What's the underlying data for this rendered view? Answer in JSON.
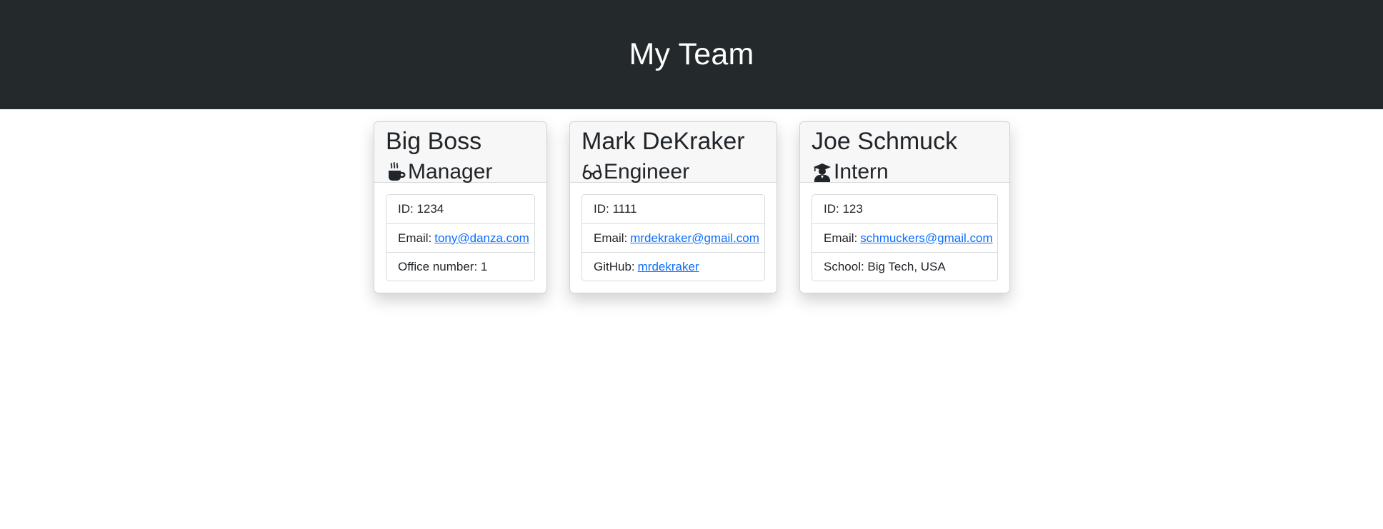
{
  "header": {
    "title": "My Team"
  },
  "colors": {
    "header_bg": "#24292c",
    "link": "#0d6efd",
    "card_header_bg": "#f7f7f7"
  },
  "cards": [
    {
      "name": "Big Boss",
      "role": "Manager",
      "role_icon": "mug-icon",
      "id_label": "ID: 1234",
      "email_label": "Email:",
      "email": "tony@danza.com",
      "extra_label": "Office number: 1"
    },
    {
      "name": "Mark DeKraker",
      "role": "Engineer",
      "role_icon": "glasses-icon",
      "id_label": "ID: 1111",
      "email_label": "Email:",
      "email": "mrdekraker@gmail.com",
      "github_label": "GitHub:",
      "github": "mrdekraker"
    },
    {
      "name": "Joe Schmuck",
      "role": "Intern",
      "role_icon": "graduate-icon",
      "id_label": "ID: 123",
      "email_label": "Email:",
      "email": "schmuckers@gmail.com",
      "extra_label": "School: Big Tech, USA"
    }
  ]
}
